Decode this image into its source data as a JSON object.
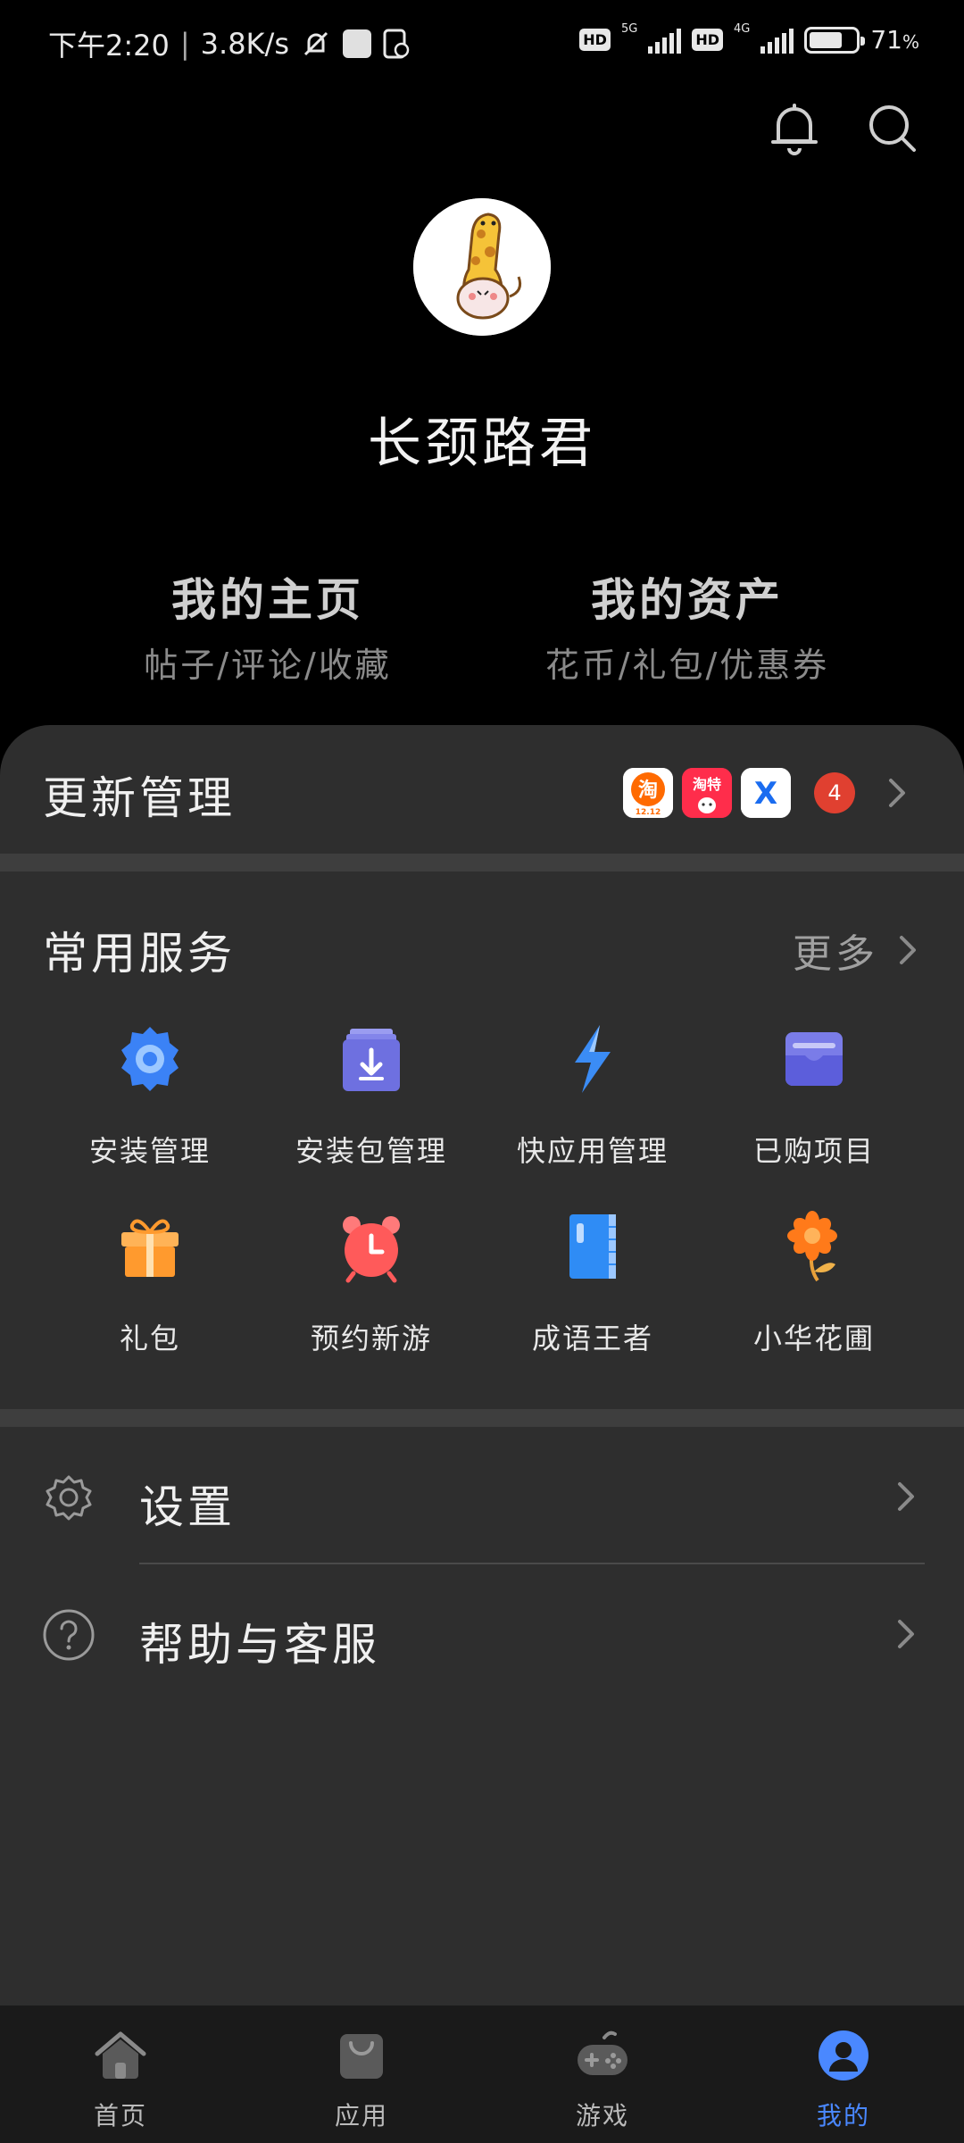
{
  "status_bar": {
    "time": "下午2:20",
    "speed": "3.8K/s",
    "hd1": "HD",
    "net1": "5G",
    "hd2": "HD",
    "net2": "4G",
    "battery": "71",
    "battery_unit": "%"
  },
  "profile": {
    "username": "长颈路君"
  },
  "quick_links": [
    {
      "title": "我的主页",
      "subtitle": "帖子/评论/收藏"
    },
    {
      "title": "我的资产",
      "subtitle": "花币/礼包/优惠券"
    }
  ],
  "update": {
    "title": "更新管理",
    "app_icons": [
      {
        "label": "淘",
        "sub": "12.12",
        "color": "#ff6a00"
      },
      {
        "label": "淘特",
        "color": "#ff2d4b"
      },
      {
        "label": "X",
        "color": "#ffffff"
      }
    ],
    "count": "4"
  },
  "services": {
    "title": "常用服务",
    "more": "更多",
    "items": [
      {
        "label": "安装管理",
        "icon": "gear-icon"
      },
      {
        "label": "安装包管理",
        "icon": "package-download-icon"
      },
      {
        "label": "快应用管理",
        "icon": "lightning-icon"
      },
      {
        "label": "已购项目",
        "icon": "wallet-icon"
      },
      {
        "label": "礼包",
        "icon": "gift-icon"
      },
      {
        "label": "预约新游",
        "icon": "alarm-clock-icon"
      },
      {
        "label": "成语王者",
        "icon": "book-icon"
      },
      {
        "label": "小华花圃",
        "icon": "flower-icon"
      }
    ]
  },
  "settings": [
    {
      "label": "设置",
      "icon": "settings-gear-icon"
    },
    {
      "label": "帮助与客服",
      "icon": "help-icon"
    }
  ],
  "bottom_nav": [
    {
      "label": "首页",
      "icon": "home-icon"
    },
    {
      "label": "应用",
      "icon": "app-bag-icon"
    },
    {
      "label": "游戏",
      "icon": "gamepad-icon"
    },
    {
      "label": "我的",
      "icon": "profile-icon",
      "active": true
    }
  ],
  "colors": {
    "accent": "#4a88ff",
    "badge": "#e04030",
    "sheet_bg": "#2e2e2e"
  }
}
